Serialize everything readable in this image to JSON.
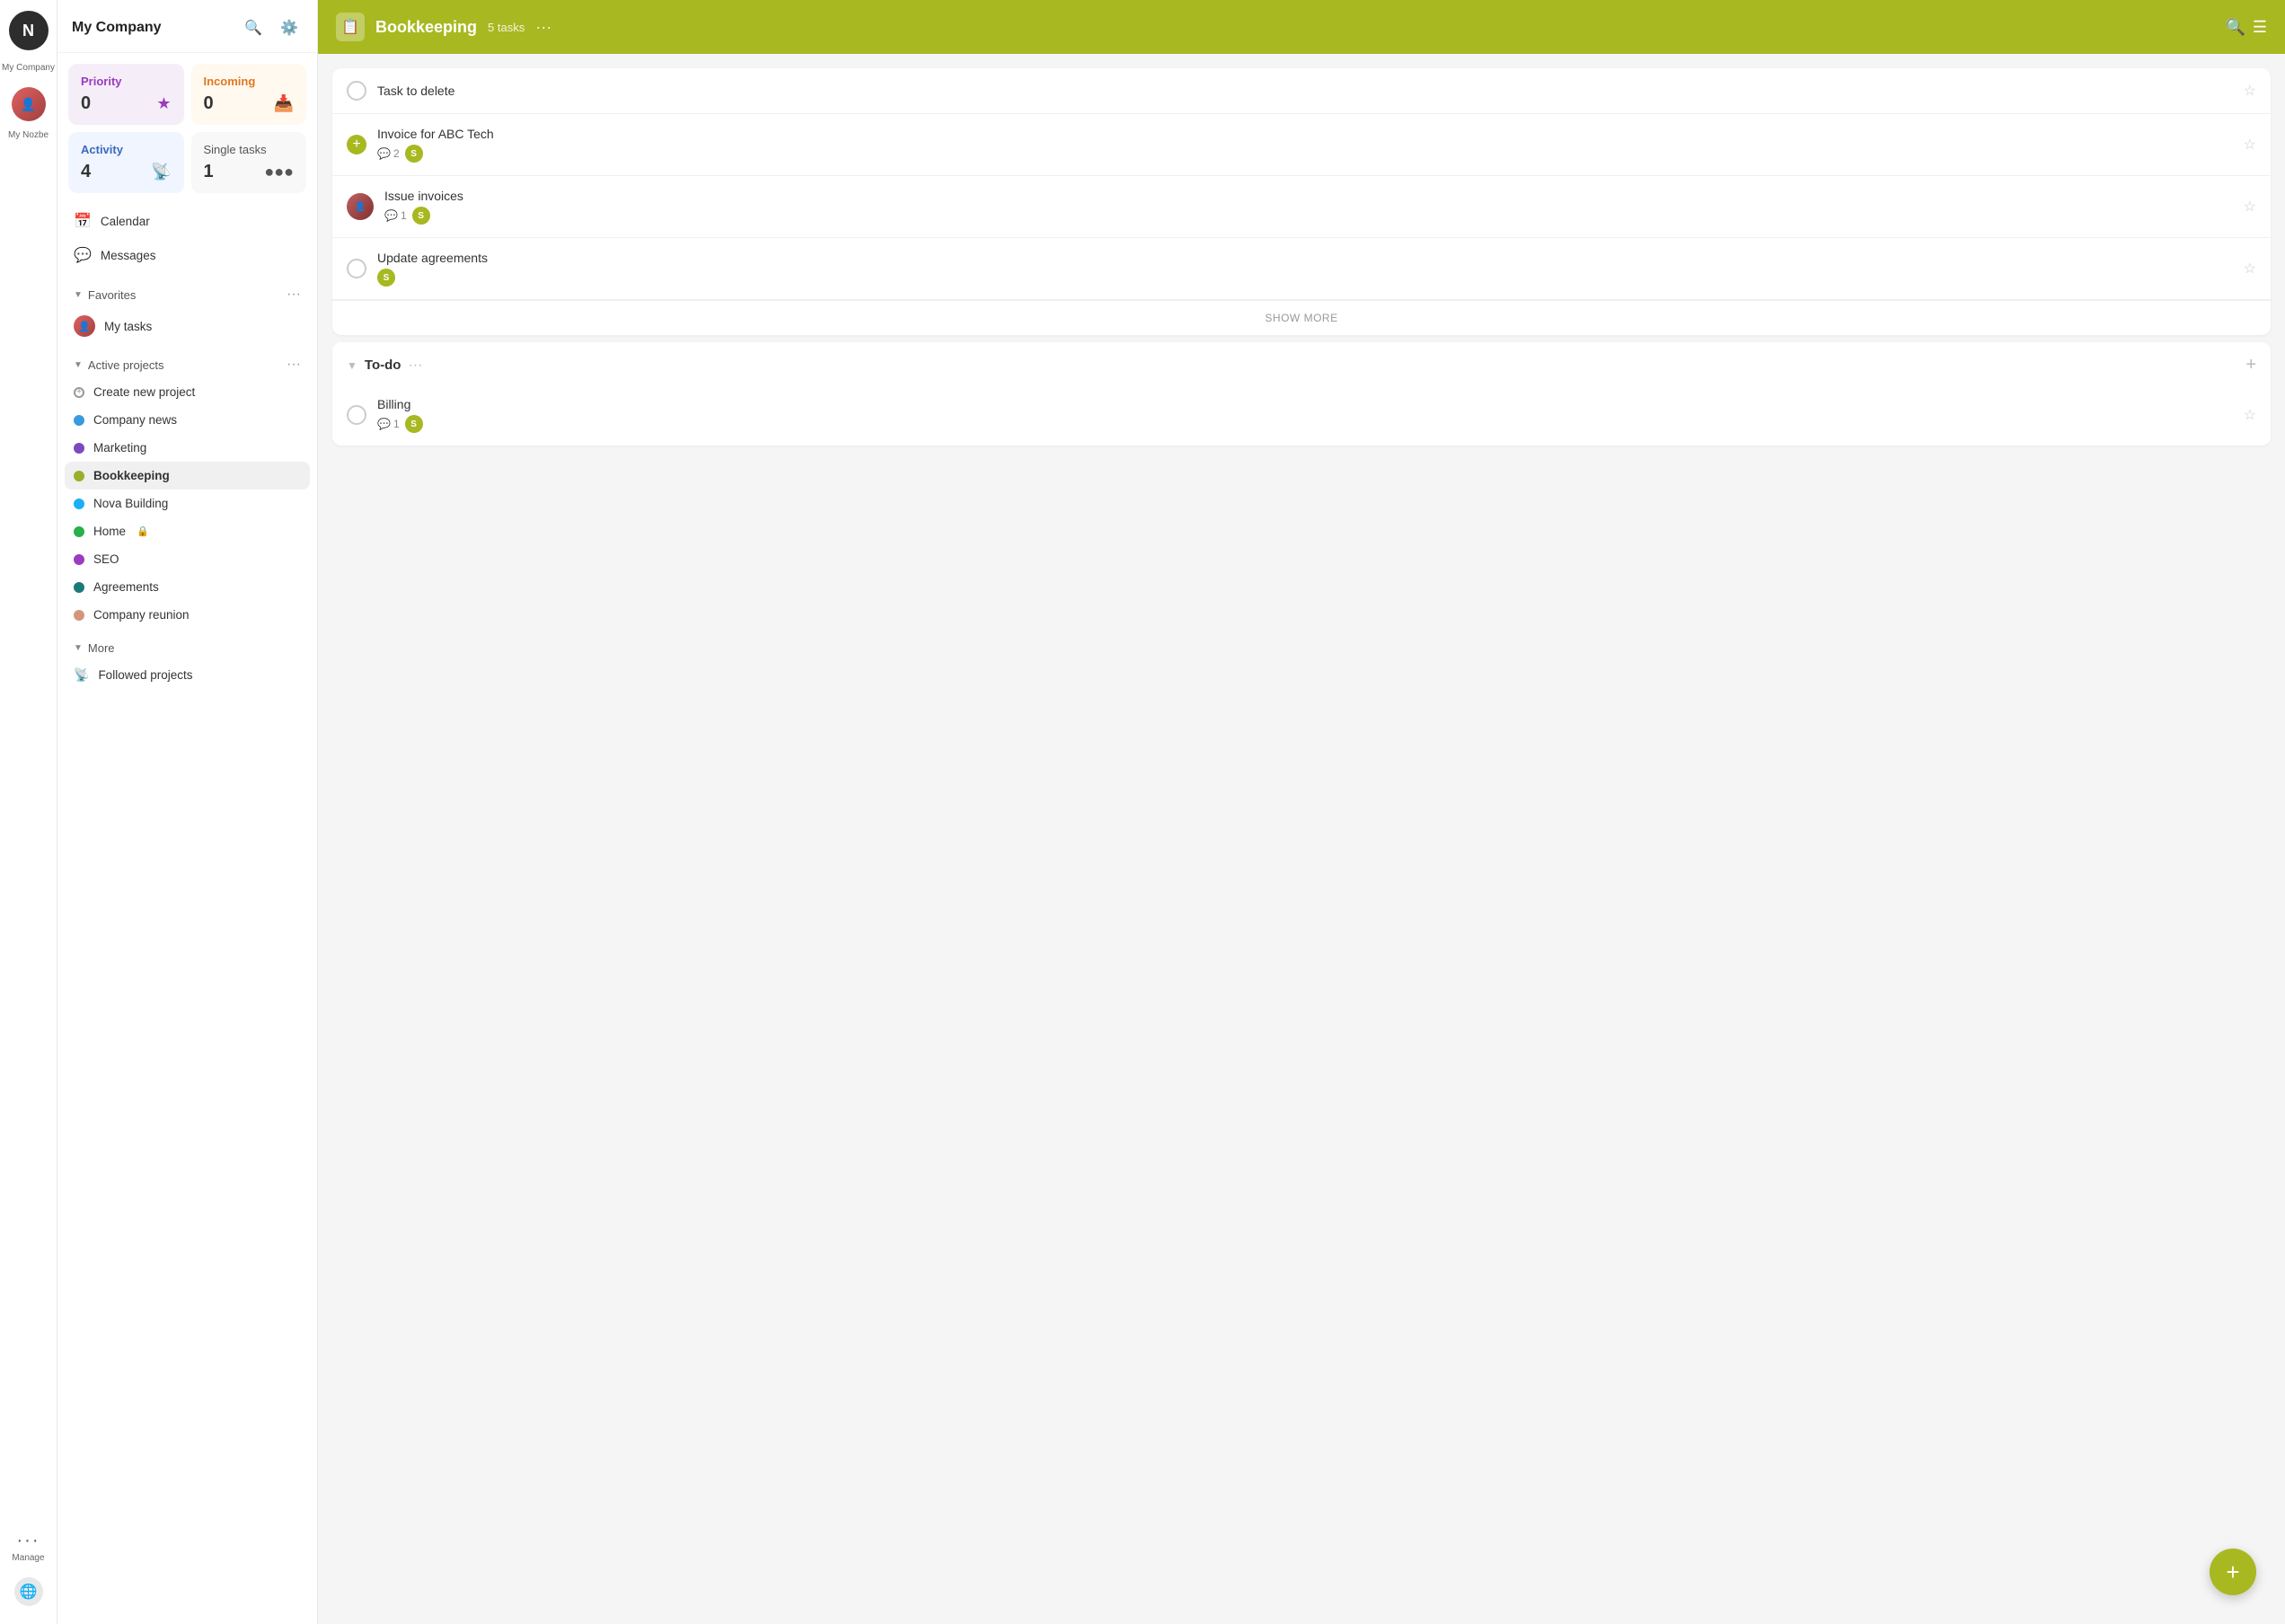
{
  "app": {
    "logo_letter": "N",
    "company_name": "My Company",
    "my_nozbe_label": "My Nozbe",
    "manage_label": "Manage"
  },
  "sidebar": {
    "search_tooltip": "Search",
    "settings_tooltip": "Settings",
    "cards": {
      "priority": {
        "title": "Priority",
        "count": "0",
        "icon": "★"
      },
      "incoming": {
        "title": "Incoming",
        "count": "0",
        "icon": "📥"
      },
      "activity": {
        "title": "Activity",
        "count": "4",
        "icon": "📡"
      },
      "single_tasks": {
        "title": "Single tasks",
        "count": "1",
        "icon": "●●●"
      }
    },
    "nav": {
      "calendar": "Calendar",
      "messages": "Messages"
    },
    "sections": {
      "favorites": {
        "label": "Favorites",
        "items": [
          {
            "name": "My tasks",
            "color": "avatar"
          }
        ]
      },
      "active_projects": {
        "label": "Active projects",
        "items": [
          {
            "name": "Create new project",
            "color": "add"
          },
          {
            "name": "Company news",
            "color": "blue"
          },
          {
            "name": "Marketing",
            "color": "purple"
          },
          {
            "name": "Bookkeeping",
            "color": "olive",
            "active": true
          },
          {
            "name": "Nova Building",
            "color": "bright-blue"
          },
          {
            "name": "Home",
            "color": "green",
            "lock": true
          },
          {
            "name": "SEO",
            "color": "dark-purple"
          },
          {
            "name": "Agreements",
            "color": "dark-teal"
          },
          {
            "name": "Company reunion",
            "color": "peach"
          }
        ]
      },
      "more": {
        "label": "More",
        "items": [
          {
            "name": "Followed projects",
            "icon": "rss"
          }
        ]
      }
    }
  },
  "main": {
    "header": {
      "title": "Bookkeeping",
      "tasks_count": "5 tasks",
      "more_icon": "···"
    },
    "tasks_section": {
      "tasks": [
        {
          "id": 1,
          "name": "Task to delete",
          "comments": 0,
          "assignee": null
        },
        {
          "id": 2,
          "name": "Invoice for ABC Tech",
          "comments": 2,
          "assignee": "S",
          "has_photo": false
        },
        {
          "id": 3,
          "name": "Issue invoices",
          "comments": 1,
          "assignee": "S",
          "has_photo": true
        },
        {
          "id": 4,
          "name": "Update agreements",
          "comments": 0,
          "assignee": "S",
          "has_photo": false
        }
      ],
      "show_more_label": "SHOW MORE"
    },
    "todo_section": {
      "title": "To-do",
      "tasks": [
        {
          "id": 5,
          "name": "Billing",
          "comments": 1,
          "assignee": "S"
        }
      ]
    }
  },
  "fab": {
    "icon": "+"
  }
}
